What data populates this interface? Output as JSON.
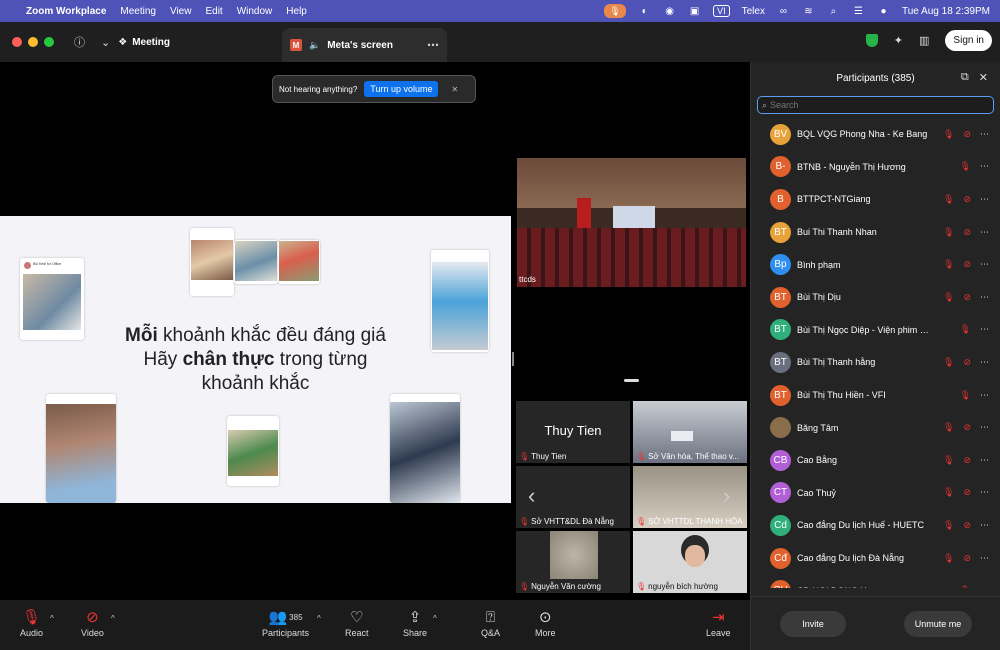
{
  "menubar": {
    "app_name": "Zoom Workplace",
    "menus": [
      "Meeting",
      "View",
      "Edit",
      "Window",
      "Help"
    ],
    "input_lang": "VI",
    "input_method": "Telex",
    "datetime": "Tue Aug 18  2:39PM"
  },
  "topbar": {
    "meeting_label": "Meeting",
    "screen_tab": "Meta's screen",
    "signin": "Sign in"
  },
  "notice": {
    "text": "Not hearing anything?",
    "button": "Turn up volume"
  },
  "slide": {
    "line1_bold": "Mỗi",
    "line1_rest": " khoảnh khắc đều đáng giá",
    "line2_pre": "Hãy ",
    "line2_bold": "chân thực",
    "line2_post": " trong từng",
    "line3": "khoảnh khắc",
    "card_caption": "Bùi Kedi for Office"
  },
  "videos": {
    "hall_label": "ttcds",
    "tiles": [
      {
        "big": "Thuy Tien",
        "name": "Thuy Tien"
      },
      {
        "name": "Sở Văn hóa, Thể thao v..."
      },
      {
        "name": "Sở VHTT&DL Đà Nẵng"
      },
      {
        "name": "SỞ VHTTDL THANH HÓA"
      },
      {
        "name": "Nguyễn Văn cường"
      },
      {
        "name": "nguyễn bích hường"
      }
    ]
  },
  "panel": {
    "title": "Participants (385)",
    "search_placeholder": "Search",
    "participants": [
      {
        "initials": "BV",
        "color": "#e8a23a",
        "name": "BQL VQG Phong Nha - Ke Bang",
        "cam": true
      },
      {
        "initials": "B-",
        "color": "#e0612d",
        "name": "BTNB - Nguyễn Thị Hương",
        "cam": false
      },
      {
        "initials": "B",
        "color": "#e0612d",
        "name": "BTTPCT-NTGiang",
        "cam": true
      },
      {
        "initials": "BT",
        "color": "#e8a23a",
        "name": "Bui Thi Thanh Nhan",
        "cam": true
      },
      {
        "initials": "Bp",
        "color": "#2f8ef0",
        "name": "Bình phạm",
        "cam": true
      },
      {
        "initials": "BT",
        "color": "#e0612d",
        "name": "Bùi Thị Dịu",
        "cam": true
      },
      {
        "initials": "BT",
        "color": "#2faf7a",
        "name": "Bùi Thị Ngọc Diệp - Viện phim Việt...",
        "cam": false
      },
      {
        "initials": "BT",
        "color": "#6a6f80",
        "name": "Bùi Thị Thanh hằng",
        "cam": true
      },
      {
        "initials": "BT",
        "color": "#e0612d",
        "name": "Bùi Thị Thu Hiền - VFI",
        "cam": false
      },
      {
        "initials": "",
        "color": "#8a6d4b",
        "name": "Băng Tâm",
        "cam": true
      },
      {
        "initials": "CB",
        "color": "#b25fd6",
        "name": "Cao Bằng",
        "cam": true
      },
      {
        "initials": "CT",
        "color": "#b25fd6",
        "name": "Cao Thuỷ",
        "cam": true
      },
      {
        "initials": "Cd",
        "color": "#2faf7a",
        "name": "Cao đẳng Du lịch Huế - HUETC",
        "cam": true
      },
      {
        "initials": "Cđ",
        "color": "#e0612d",
        "name": "Cao đẳng Du lịch Đà Nẵng",
        "cam": true
      },
      {
        "initials": "CH",
        "color": "#e0612d",
        "name": "CD HOI DONG X",
        "cam": false
      }
    ],
    "invite": "Invite",
    "unmute_me": "Unmute me"
  },
  "toolbar": {
    "audio": "Audio",
    "video": "Video",
    "participants": "Participants",
    "participants_count": "385",
    "react": "React",
    "share": "Share",
    "qa": "Q&A",
    "more": "More",
    "leave": "Leave"
  },
  "colors": {
    "menubar_bg": "#4f53b7",
    "accent_blue": "#0e72ed",
    "muted_red": "#e33333"
  }
}
